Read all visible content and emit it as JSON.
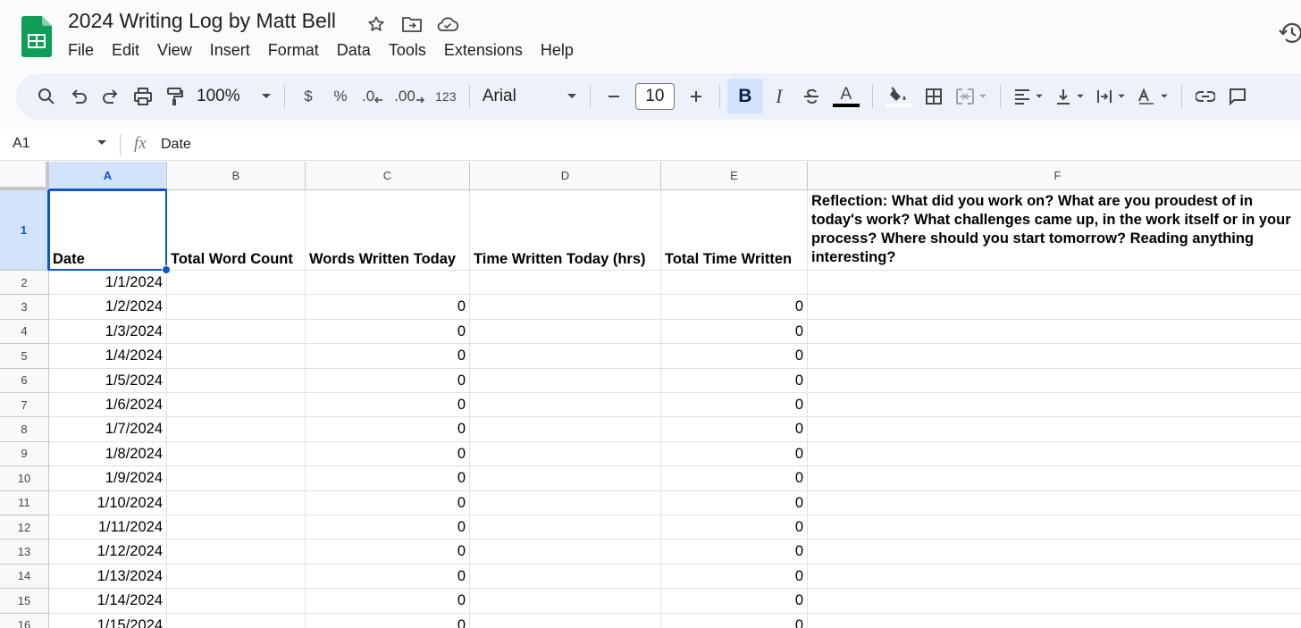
{
  "header": {
    "title": "2024 Writing Log by Matt Bell",
    "menu": [
      "File",
      "Edit",
      "View",
      "Insert",
      "Format",
      "Data",
      "Tools",
      "Extensions",
      "Help"
    ]
  },
  "toolbar": {
    "zoom": "100%",
    "currency": "$",
    "percent": "%",
    "decrease_decimal": ".0",
    "increase_decimal": ".00",
    "format_123": "123",
    "font": "Arial",
    "font_size": "10",
    "bold": "B",
    "italic": "I",
    "text_color_letter": "A"
  },
  "formula_bar": {
    "cell_ref": "A1",
    "fx": "fx",
    "value": "Date"
  },
  "colors": {
    "accent": "#0b57d0",
    "selection_fill": "#d3e3fd",
    "sheets_green": "#0f9d58"
  },
  "sheet": {
    "columns": [
      "A",
      "B",
      "C",
      "D",
      "E",
      "F"
    ],
    "headers": [
      "Date",
      "Total Word Count",
      "Words Written Today",
      "Time Written Today (hrs)",
      "Total Time Written",
      "Reflection: What did you work on? What are you proudest of in today's work? What challenges came up, in the work itself or in your process? Where should you start tomorrow? Reading anything interesting?"
    ],
    "rows": [
      {
        "n": "2",
        "date": "1/1/2024",
        "c": "",
        "e": ""
      },
      {
        "n": "3",
        "date": "1/2/2024",
        "c": "0",
        "e": "0"
      },
      {
        "n": "4",
        "date": "1/3/2024",
        "c": "0",
        "e": "0"
      },
      {
        "n": "5",
        "date": "1/4/2024",
        "c": "0",
        "e": "0"
      },
      {
        "n": "6",
        "date": "1/5/2024",
        "c": "0",
        "e": "0"
      },
      {
        "n": "7",
        "date": "1/6/2024",
        "c": "0",
        "e": "0"
      },
      {
        "n": "8",
        "date": "1/7/2024",
        "c": "0",
        "e": "0"
      },
      {
        "n": "9",
        "date": "1/8/2024",
        "c": "0",
        "e": "0"
      },
      {
        "n": "10",
        "date": "1/9/2024",
        "c": "0",
        "e": "0"
      },
      {
        "n": "11",
        "date": "1/10/2024",
        "c": "0",
        "e": "0"
      },
      {
        "n": "12",
        "date": "1/11/2024",
        "c": "0",
        "e": "0"
      },
      {
        "n": "13",
        "date": "1/12/2024",
        "c": "0",
        "e": "0"
      },
      {
        "n": "14",
        "date": "1/13/2024",
        "c": "0",
        "e": "0"
      },
      {
        "n": "15",
        "date": "1/14/2024",
        "c": "0",
        "e": "0"
      },
      {
        "n": "16",
        "date": "1/15/2024",
        "c": "0",
        "e": "0"
      }
    ]
  }
}
